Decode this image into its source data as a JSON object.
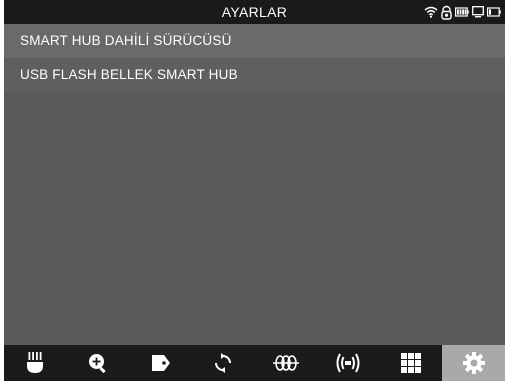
{
  "header": {
    "title": "AYARLAR",
    "status_icons": [
      "wifi-icon",
      "headset-icon",
      "battery-full-icon",
      "monitor-icon",
      "battery-low-icon"
    ]
  },
  "list": {
    "items": [
      {
        "label": "SMART HUB DAHİLİ SÜRÜCÜSÜ",
        "selected": true
      },
      {
        "label": "USB FLASH BELLEK SMART HUB",
        "selected": false
      }
    ]
  },
  "toolbar": {
    "buttons": [
      {
        "icon": "probe-icon",
        "active": false
      },
      {
        "icon": "zoom-in-icon",
        "active": false
      },
      {
        "icon": "tag-icon",
        "active": false
      },
      {
        "icon": "rotate-icon",
        "active": false
      },
      {
        "icon": "filter-waveform-icon",
        "active": false
      },
      {
        "icon": "signal-icon",
        "active": false
      },
      {
        "icon": "grid-icon",
        "active": false
      },
      {
        "icon": "settings-gear-icon",
        "active": true
      }
    ]
  },
  "colors": {
    "background": "#5a5a5a",
    "statusbar": "#1a1a1a",
    "toolbar": "#1b1b1b",
    "active_tab": "#a9a9a9",
    "text": "#ffffff"
  }
}
